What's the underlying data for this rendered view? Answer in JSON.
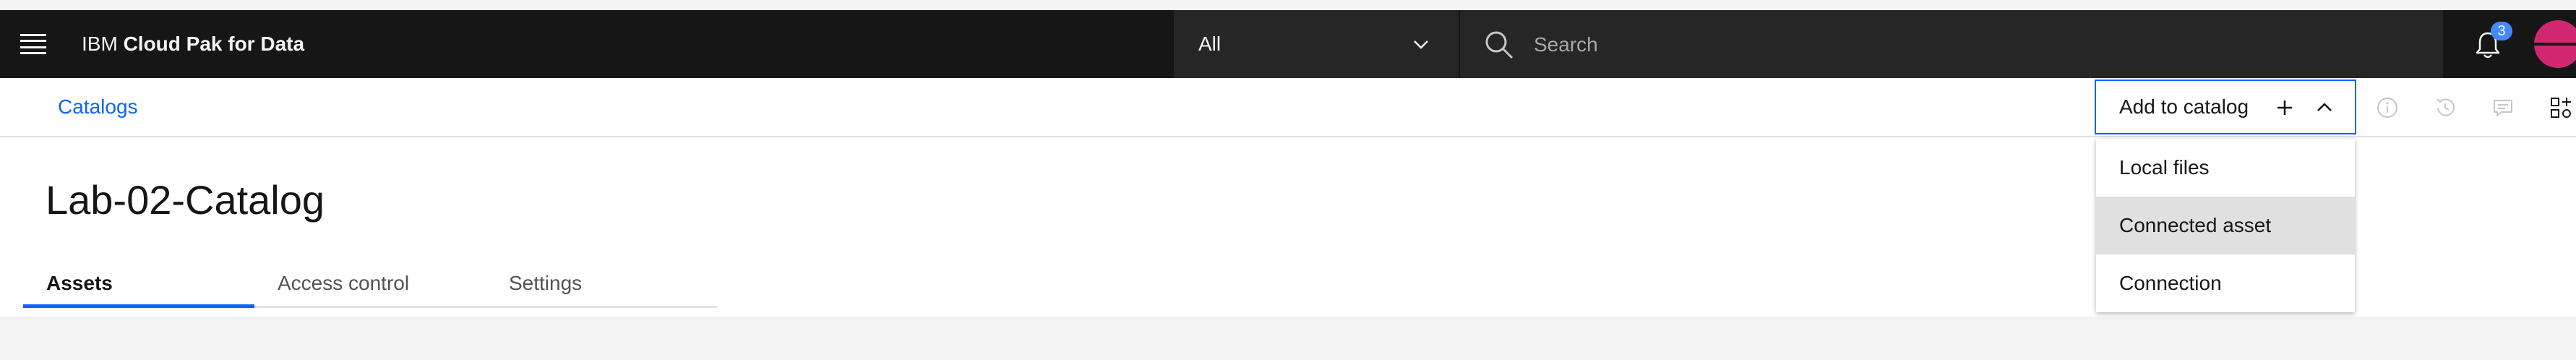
{
  "header": {
    "brand_prefix": "IBM",
    "brand_name": "Cloud Pak for Data",
    "scope_value": "All",
    "search_placeholder": "Search",
    "notification_count": "3"
  },
  "breadcrumb": {
    "label": "Catalogs"
  },
  "toolbar": {
    "add_label": "Add to catalog",
    "menu": [
      "Local files",
      "Connected asset",
      "Connection"
    ]
  },
  "page": {
    "title": "Lab-02-Catalog",
    "tabs": [
      "Assets",
      "Access control",
      "Settings"
    ]
  },
  "icons": {
    "menu": "hamburger-icon",
    "scope": "chevron-down-icon",
    "search": "search-icon",
    "notifications": "bell-icon",
    "add": "plus-icon",
    "collapse": "chevron-up-icon",
    "info": "info-icon",
    "history": "history-icon",
    "comments": "comment-icon",
    "apps": "apps-icon"
  },
  "colors": {
    "brand_blue": "#0f62fe",
    "header_bg": "#161616",
    "avatar": "#d12771",
    "badge": "#4589ff"
  }
}
